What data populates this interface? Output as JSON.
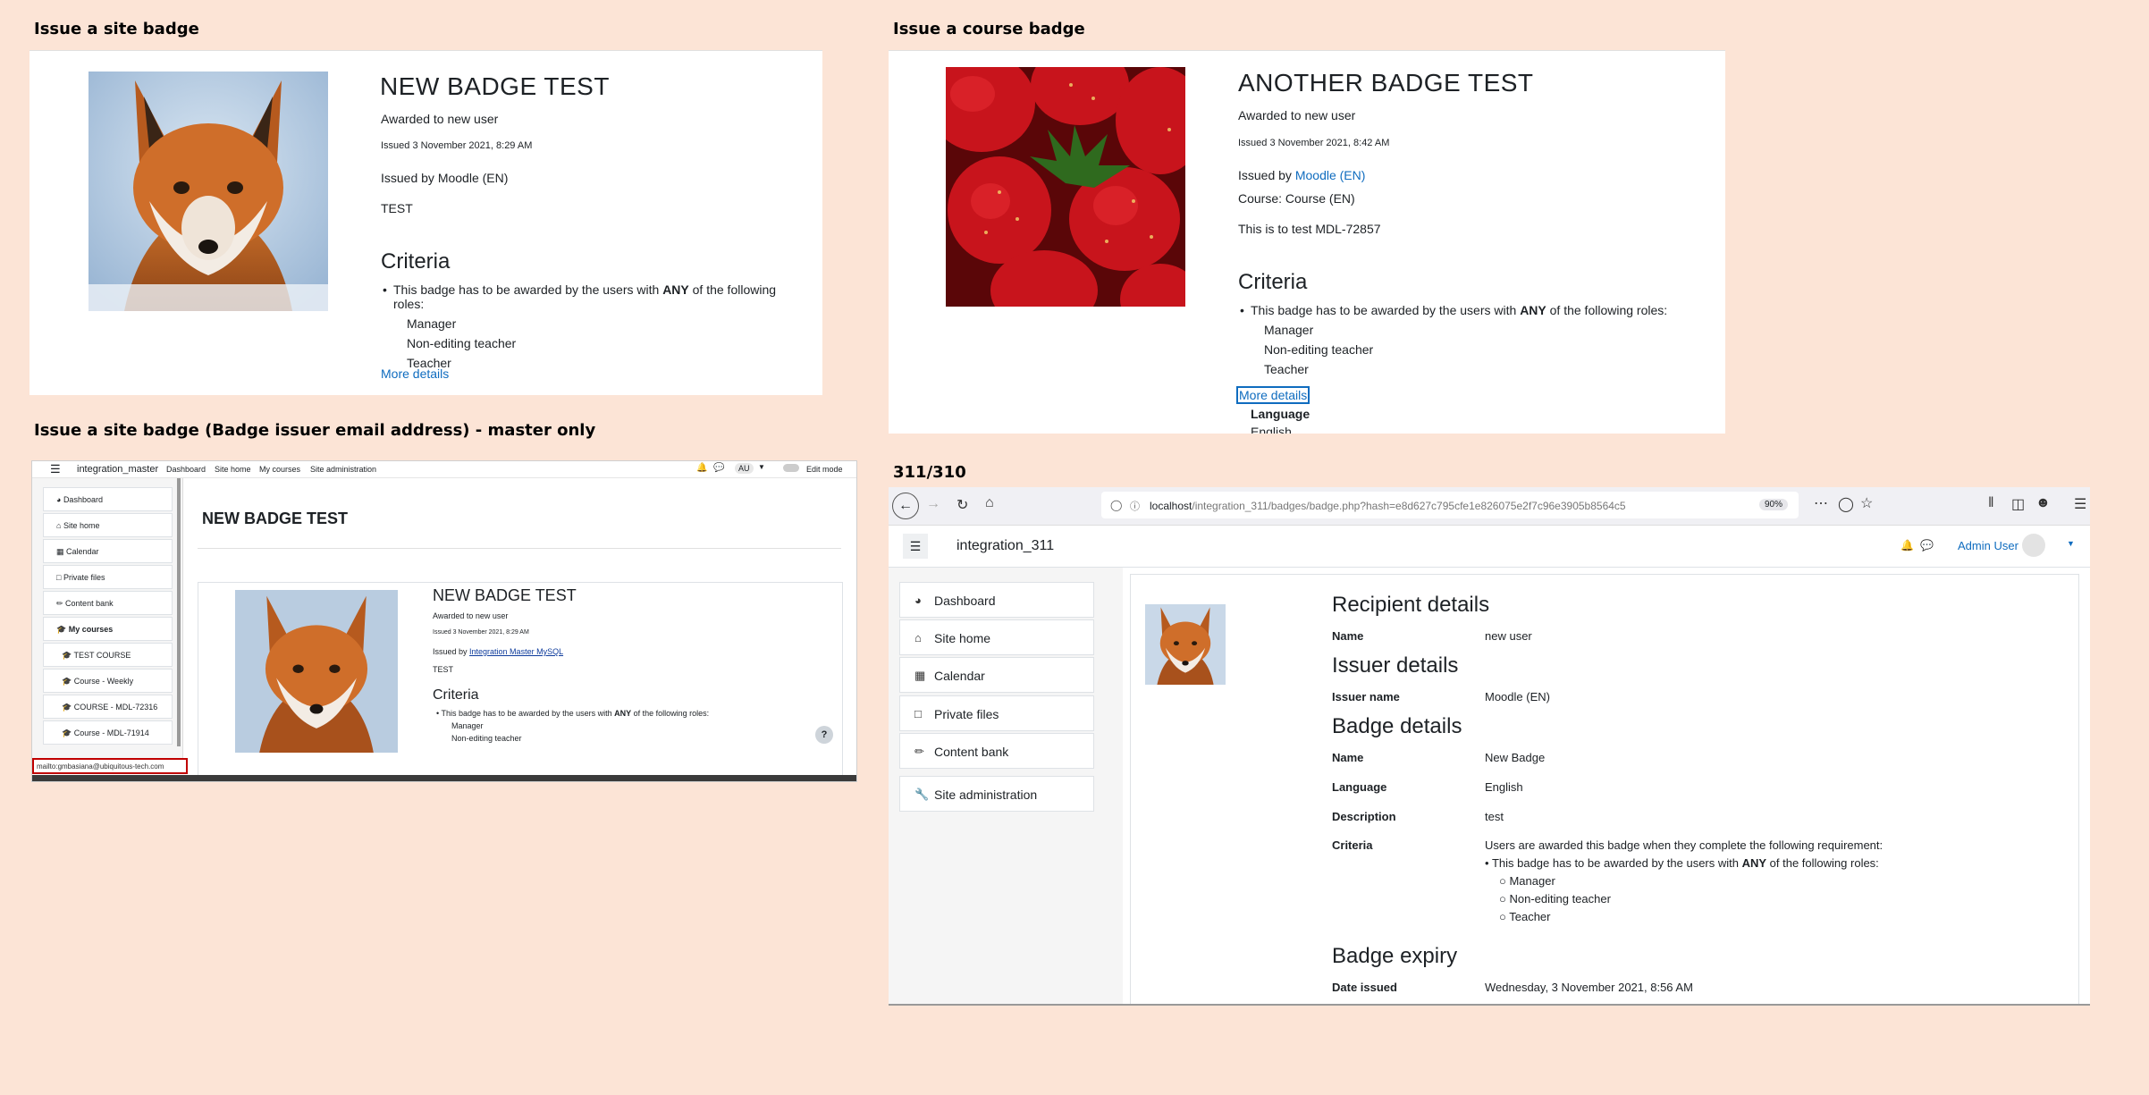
{
  "headings": {
    "site_badge": "Issue a site badge",
    "course_badge": "Issue a course badge",
    "email_badge": "Issue a site badge (Badge issuer email address) - master only",
    "version": "311/310"
  },
  "panel1": {
    "title": "NEW BADGE TEST",
    "awarded": "Awarded to new user",
    "issued": "Issued 3 November 2021, 8:29 AM",
    "issued_by": "Issued by Moodle (EN)",
    "description": "TEST",
    "criteria_heading": "Criteria",
    "criteria_pre": "This badge has to be awarded by the users with ",
    "criteria_any": "ANY",
    "criteria_post": " of the following roles:",
    "roles": [
      "Manager",
      "Non-editing teacher",
      "Teacher"
    ],
    "more_details": "More details"
  },
  "panel2": {
    "title": "ANOTHER BADGE TEST",
    "awarded": "Awarded to new user",
    "issued": "Issued 3 November 2021, 8:42 AM",
    "issued_by_prefix": "Issued by ",
    "issued_by_link": "Moodle (EN)",
    "course": "Course: Course (EN)",
    "description": "This is to test MDL-72857",
    "criteria_heading": "Criteria",
    "criteria_pre": "This badge has to be awarded by the users with ",
    "criteria_any": "ANY",
    "criteria_post": " of the following roles:",
    "roles": [
      "Manager",
      "Non-editing teacher",
      "Teacher"
    ],
    "more_details": "More details",
    "language_label": "Language",
    "language_value": "English"
  },
  "panel3": {
    "site_name": "integration_master",
    "nav": [
      "Dashboard",
      "Site home",
      "My courses",
      "Site administration"
    ],
    "avatar": "AU",
    "edit_mode": "Edit mode",
    "page_title": "NEW BADGE TEST",
    "sidebar": [
      "Dashboard",
      "Site home",
      "Calendar",
      "Private files",
      "Content bank",
      "My courses",
      "TEST COURSE",
      "Course - Weekly",
      "COURSE - MDL-72316",
      "Course - MDL-71914"
    ],
    "badge_title": "NEW BADGE TEST",
    "awarded": "Awarded to new user",
    "issued": "Issued 3 November 2021, 8:29 AM",
    "issued_by_prefix": "Issued by ",
    "issued_by_link": "Integration Master MySQL",
    "description": "TEST",
    "criteria_heading": "Criteria",
    "criteria_pre": "This badge has to be awarded by the users with ",
    "criteria_any": "ANY",
    "criteria_post": " of the following roles:",
    "roles": [
      "Manager",
      "Non-editing teacher"
    ],
    "status_url": "mailto:gmbasiana@ubiquitous-tech.com",
    "help": "?"
  },
  "panel4": {
    "url_host": "localhost",
    "url_path": "/integration_311/badges/badge.php?hash=e8d627c795cfe1e826075e2f7c96e3905b8564c5",
    "zoom": "90%",
    "site_name": "integration_311",
    "user": "Admin User",
    "sidebar": [
      "Dashboard",
      "Site home",
      "Calendar",
      "Private files",
      "Content bank"
    ],
    "site_admin": "Site administration",
    "recipient_heading": "Recipient details",
    "name_label": "Name",
    "recipient_name": "new user",
    "issuer_heading": "Issuer details",
    "issuer_label": "Issuer name",
    "issuer_name": "Moodle (EN)",
    "badge_heading": "Badge details",
    "badge_name": "New Badge",
    "language_label": "Language",
    "language": "English",
    "description_label": "Description",
    "description": "test",
    "criteria_label": "Criteria",
    "criteria_intro": "Users are awarded this badge when they complete the following requirement:",
    "criteria_pre": "This badge has to be awarded by the users with ",
    "criteria_any": "ANY",
    "criteria_post": " of the following roles:",
    "roles": [
      "Manager",
      "Non-editing teacher",
      "Teacher"
    ],
    "expiry_heading": "Badge expiry",
    "date_issued_label": "Date issued",
    "date_issued": "Wednesday, 3 November 2021, 8:56 AM"
  },
  "colors": {
    "background": "#fce4d6",
    "link": "#0f6cbf"
  }
}
